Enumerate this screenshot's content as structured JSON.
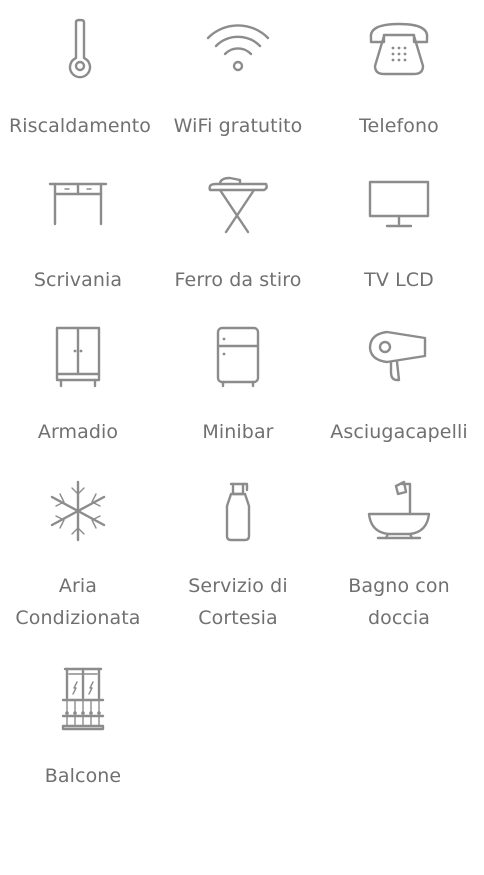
{
  "amenities": [
    {
      "label": "Riscaldamento",
      "icon": "thermometer-icon"
    },
    {
      "label": "WiFi gratutito",
      "icon": "wifi-icon"
    },
    {
      "label": "Telefono",
      "icon": "telephone-icon"
    },
    {
      "label": "Scrivania",
      "icon": "desk-icon"
    },
    {
      "label": "Ferro da stiro",
      "icon": "iron-icon"
    },
    {
      "label": "TV LCD",
      "icon": "tv-icon"
    },
    {
      "label": "Armadio",
      "icon": "wardrobe-icon"
    },
    {
      "label": "Minibar",
      "icon": "fridge-icon"
    },
    {
      "label": "Asciugacapelli",
      "icon": "hairdryer-icon"
    },
    {
      "label": "Aria Condizionata",
      "icon": "snowflake-icon"
    },
    {
      "label": "Servizio di Cortesia",
      "icon": "soap-dispenser-icon"
    },
    {
      "label": "Bagno con doccia",
      "icon": "bathtub-shower-icon"
    },
    {
      "label": "Balcone",
      "icon": "balcony-icon"
    }
  ],
  "colors": {
    "icon": "#8c8c8c",
    "text": "#707070",
    "background": "#ffffff"
  }
}
